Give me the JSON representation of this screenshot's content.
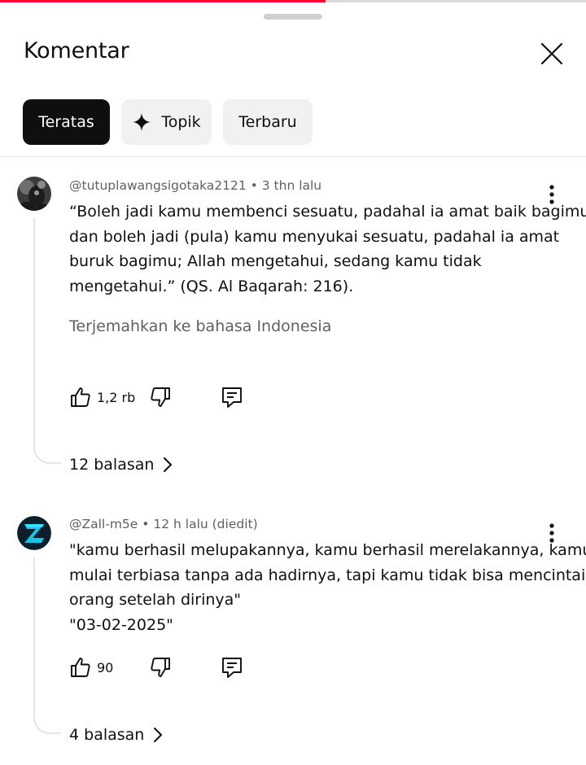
{
  "progress": {
    "fraction": 0.555,
    "fill_color": "#ff0033"
  },
  "header": {
    "title": "Komentar",
    "close_icon": "close-icon"
  },
  "filters": [
    {
      "label": "Teratas",
      "selected": true
    },
    {
      "label": "Topik",
      "icon": "sparkle-icon",
      "selected": false
    },
    {
      "label": "Terbaru",
      "selected": false
    }
  ],
  "comments": [
    {
      "author": "@tutuplawangsigotaka2121",
      "separator": "•",
      "time": "3 thn lalu",
      "text_lines": [
        "“Boleh jadi kamu membenci sesuatu, padahal ia amat baik bagimu,",
        "dan boleh jadi (pula) kamu menyukai sesuatu, padahal ia amat",
        "buruk bagimu; Allah mengetahui, sedang kamu tidak",
        "mengetahui.” (QS. Al Baqarah: 216)."
      ],
      "translate": "Terjemahkan ke bahasa Indonesia",
      "likes": "1,2 rb",
      "replies": "12 balasan"
    },
    {
      "author": "@Zall-m5e",
      "separator": "•",
      "time": "12 h lalu (diedit)",
      "text_lines": [
        "\"kamu berhasil melupakannya, kamu berhasil merelakannya, kamu",
        "mulai terbiasa tanpa ada hadirnya, tapi kamu tidak bisa mencintai",
        "orang setelah dirinya\"",
        "\"03-02-2025\""
      ],
      "likes": "90",
      "replies": "4 balasan"
    }
  ]
}
